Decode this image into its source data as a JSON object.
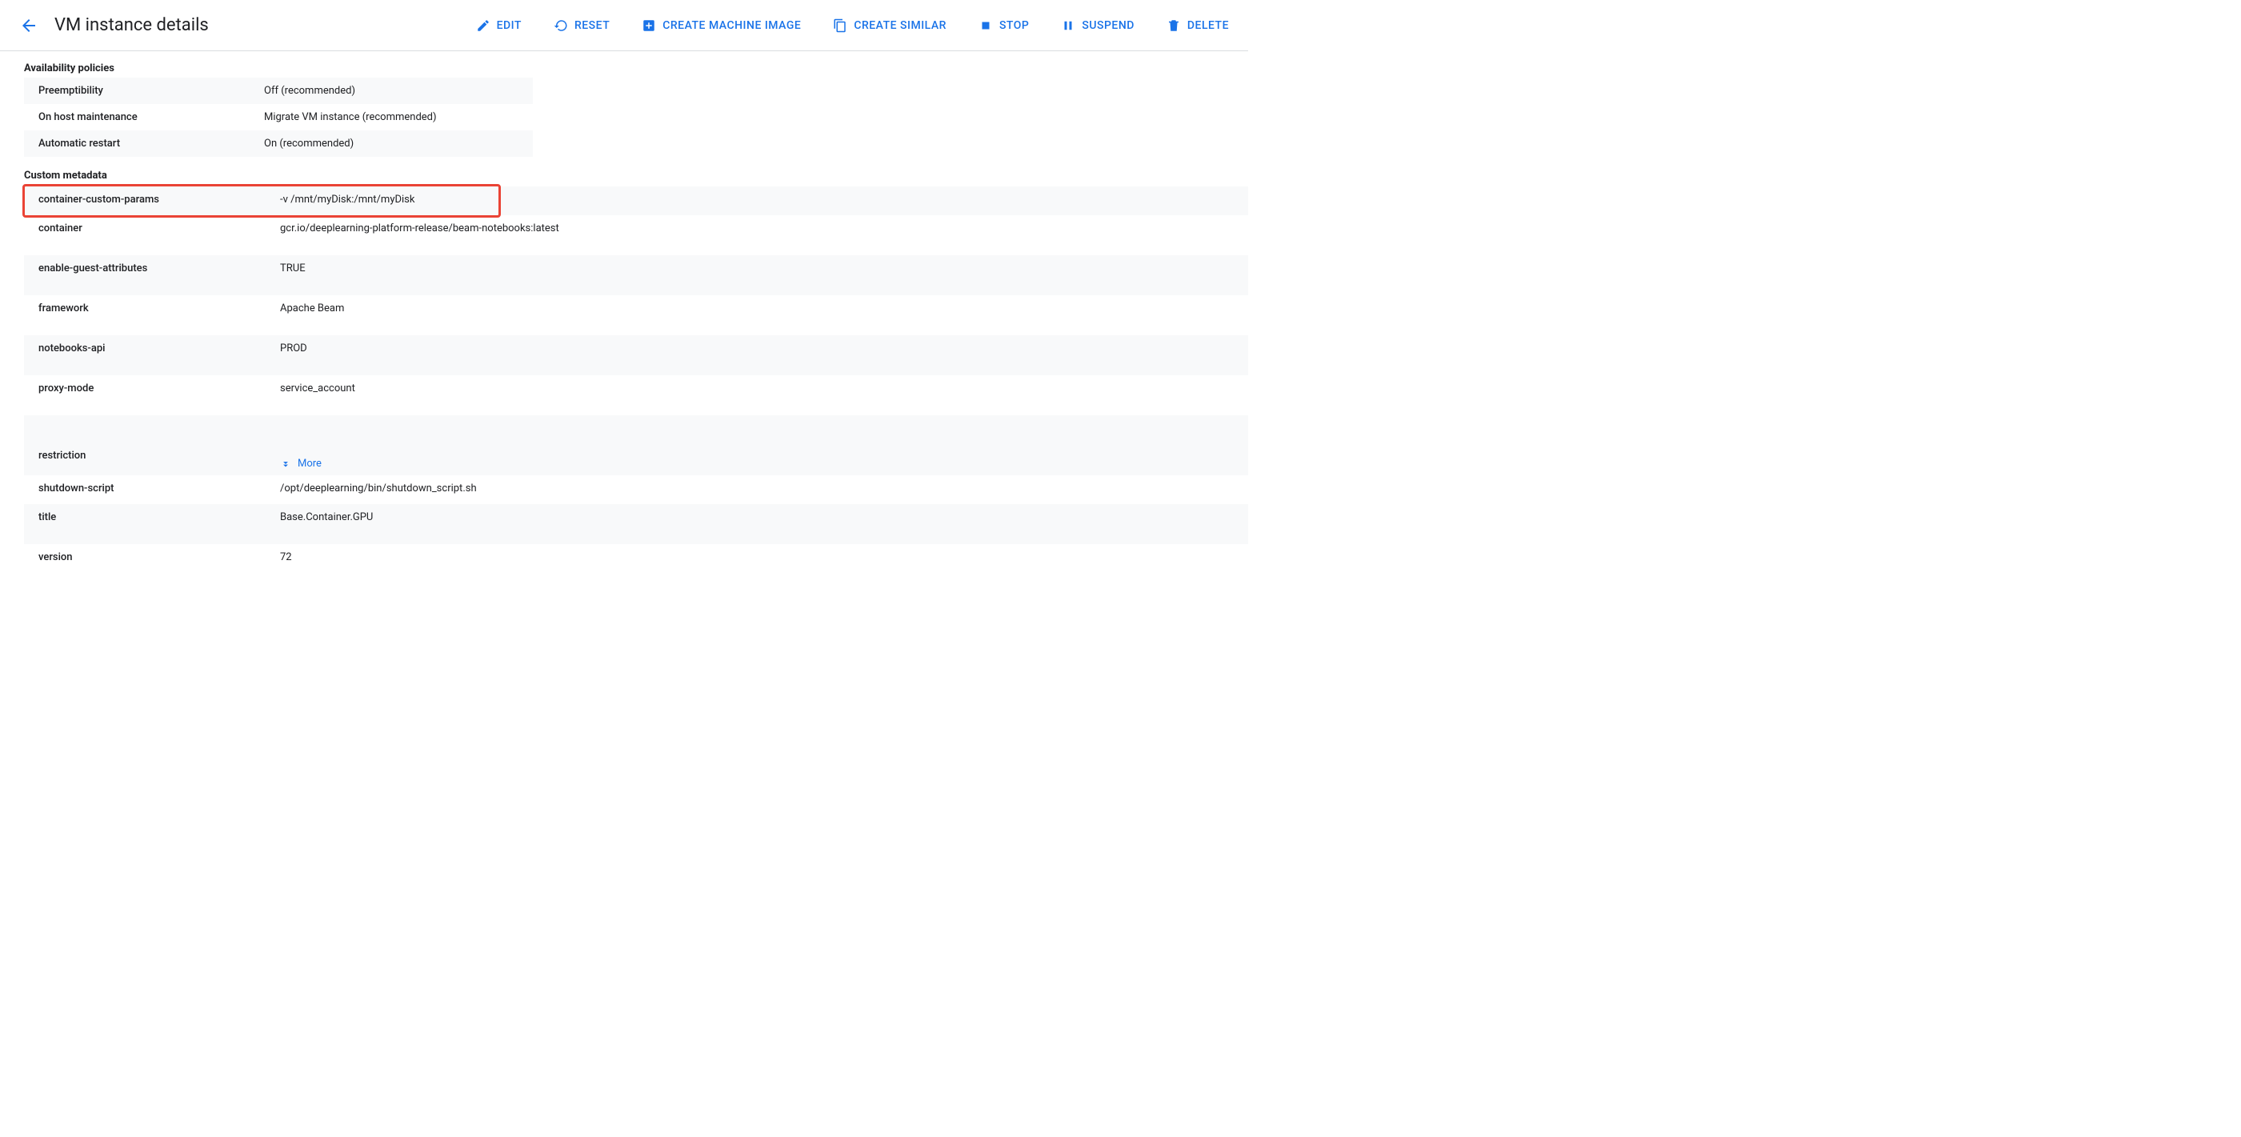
{
  "header": {
    "title": "VM instance details",
    "actions": {
      "edit": "EDIT",
      "reset": "RESET",
      "create_machine_image": "CREATE MACHINE IMAGE",
      "create_similar": "CREATE SIMILAR",
      "stop": "STOP",
      "suspend": "SUSPEND",
      "delete": "DELETE"
    }
  },
  "sections": {
    "availability_title": "Availability policies",
    "custom_metadata_title": "Custom metadata"
  },
  "availability": {
    "preemptibility_key": "Preemptibility",
    "preemptibility_val": "Off (recommended)",
    "on_host_key": "On host maintenance",
    "on_host_val": "Migrate VM instance (recommended)",
    "auto_restart_key": "Automatic restart",
    "auto_restart_val": "On (recommended)"
  },
  "metadata": {
    "row0": {
      "key": "container-custom-params",
      "val": "-v /mnt/myDisk:/mnt/myDisk"
    },
    "row1": {
      "key": "container",
      "val": "gcr.io/deeplearning-platform-release/beam-notebooks:latest"
    },
    "row2": {
      "key": "enable-guest-attributes",
      "val": "TRUE"
    },
    "row3": {
      "key": "framework",
      "val": "Apache Beam"
    },
    "row4": {
      "key": "notebooks-api",
      "val": "PROD"
    },
    "row5": {
      "key": "proxy-mode",
      "val": "service_account"
    },
    "row6": {
      "key": "restriction",
      "more": "More"
    },
    "row7": {
      "key": "shutdown-script",
      "val": "/opt/deeplearning/bin/shutdown_script.sh"
    },
    "row8": {
      "key": "title",
      "val": "Base.Container.GPU"
    },
    "row9": {
      "key": "version",
      "val": "72"
    }
  }
}
